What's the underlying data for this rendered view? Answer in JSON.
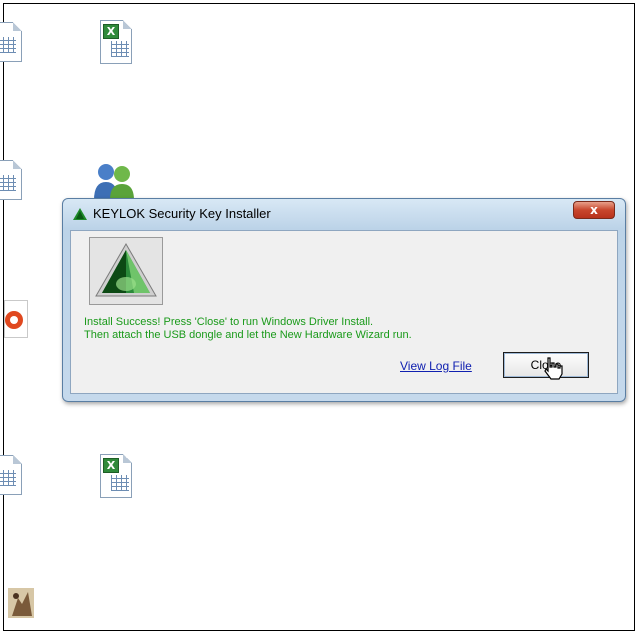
{
  "dialog": {
    "title": "KEYLOK Security Key Installer",
    "close_x": "x",
    "message_line1": "Install Success!  Press 'Close' to run Windows Driver Install.",
    "message_line2": "Then attach the USB dongle and let the New Hardware Wizard run.",
    "log_link": "View Log File",
    "close_button": "Close"
  },
  "desktop": {
    "icons": [
      "spreadsheet-icon",
      "excel-file-icon",
      "users-icon",
      "powerpoint-icon",
      "image-icon"
    ]
  },
  "colors": {
    "message_text": "#1a9a1a",
    "link": "#1020b0",
    "close_x": "#c8462c"
  }
}
